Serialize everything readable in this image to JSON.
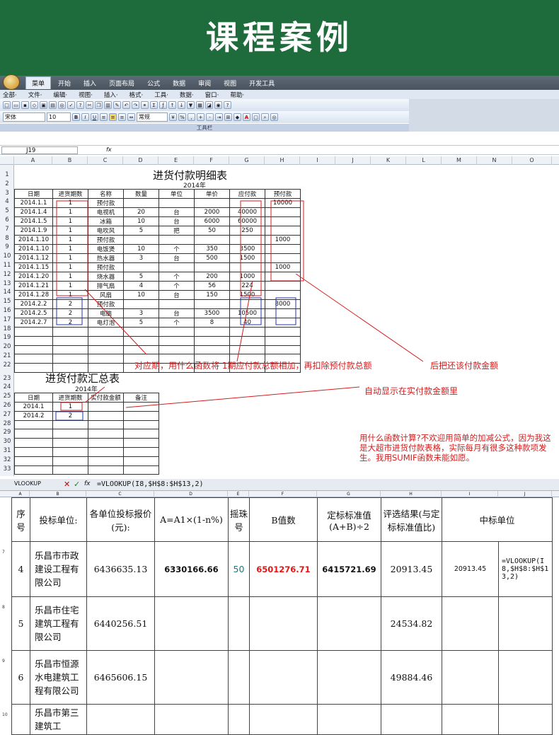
{
  "banner": {
    "title": "课程案例"
  },
  "excel": {
    "ribbon_tabs": [
      "菜单",
      "开始",
      "插入",
      "页面布局",
      "公式",
      "数据",
      "审阅",
      "视图",
      "开发工具"
    ],
    "menu_items": [
      "全部·",
      "文件·",
      "编辑·",
      "视图·",
      "插入·",
      "格式·",
      "工具·",
      "数据·",
      "窗口·",
      "帮助·"
    ],
    "font_name": "宋体",
    "font_size": "10",
    "number_format": "常规",
    "toolbar_label": "工具栏",
    "name_box": "J19",
    "fx_label": "fx",
    "columns": [
      "A",
      "B",
      "C",
      "D",
      "E",
      "F",
      "G",
      "H",
      "I",
      "J",
      "K",
      "L",
      "M",
      "N",
      "O"
    ],
    "rows": [
      "1",
      "2",
      "3",
      "4",
      "5",
      "6",
      "7",
      "8",
      "9",
      "10",
      "11",
      "12",
      "13",
      "14",
      "15",
      "16",
      "17",
      "18",
      "19",
      "20",
      "21",
      "22",
      "23",
      "24",
      "25",
      "26",
      "27",
      "28",
      "29",
      "30",
      "31",
      "32",
      "33"
    ]
  },
  "detail": {
    "title": "进货付款明细表",
    "year": "2014年",
    "headers": [
      "日期",
      "进货期数",
      "名称",
      "数量",
      "单位",
      "单价",
      "应付款",
      "预付款"
    ],
    "rows": [
      [
        "2014.1.1",
        "1",
        "预付款",
        "",
        "",
        "",
        "",
        "10000"
      ],
      [
        "2014.1.4",
        "1",
        "电视机",
        "20",
        "台",
        "2000",
        "40000",
        ""
      ],
      [
        "2014.1.5",
        "1",
        "冰箱",
        "10",
        "台",
        "6000",
        "60000",
        ""
      ],
      [
        "2014.1.9",
        "1",
        "电吹风",
        "5",
        "把",
        "50",
        "250",
        ""
      ],
      [
        "2014.1.10",
        "1",
        "预付款",
        "",
        "",
        "",
        "",
        "1000"
      ],
      [
        "2014.1.10",
        "1",
        "电饭煲",
        "10",
        "个",
        "350",
        "3500",
        ""
      ],
      [
        "2014.1.12",
        "1",
        "热水器",
        "3",
        "台",
        "500",
        "1500",
        ""
      ],
      [
        "2014.1.15",
        "1",
        "预付款",
        "",
        "",
        "",
        "",
        "1000"
      ],
      [
        "2014.1.20",
        "1",
        "烧水器",
        "5",
        "个",
        "200",
        "1000",
        ""
      ],
      [
        "2014.1.21",
        "1",
        "排气扇",
        "4",
        "个",
        "56",
        "224",
        ""
      ],
      [
        "2014.1.28",
        "1",
        "风扇",
        "10",
        "台",
        "150",
        "1500",
        ""
      ],
      [
        "2014.2.2",
        "2",
        "预付款",
        "",
        "",
        "",
        "",
        "8000"
      ],
      [
        "2014.2.5",
        "2",
        "电脑",
        "3",
        "台",
        "3500",
        "10500",
        ""
      ],
      [
        "2014.2.7",
        "2",
        "电灯泡",
        "5",
        "个",
        "8",
        "40",
        ""
      ]
    ]
  },
  "summary": {
    "title": "进货付款汇总表",
    "year": "2014年",
    "headers": [
      "日期",
      "进货期数",
      "实付款金额",
      "备注"
    ],
    "rows": [
      [
        "2014.1",
        "1",
        "",
        ""
      ],
      [
        "2014.2",
        "2",
        "",
        ""
      ]
    ]
  },
  "annotations": {
    "question": "对应期，用什么函数将 1期应付款总额相加，再扣除预付款总额",
    "question_tail": "后把还该付款金额",
    "auto_display": "自动显示在实付款金额里",
    "sumif_note": "用什么函数计算?不欢迎用简单的加减公式，因为我这是大超市进货付款表格，实际每月有很多这种款项发生。我用SUMIF函数未能如愿。"
  },
  "bid": {
    "name_box": "VLOOKUP",
    "formula": "=VLOOKUP(I8,$H$8:$H$13,2)",
    "cols": [
      "A",
      "B",
      "C",
      "D",
      "E",
      "F",
      "G",
      "H",
      "I",
      "J"
    ],
    "headers": {
      "seq": "序号",
      "bidder": "投标单位:",
      "price": "各单位投标报价(元):",
      "a_formula": "A=A1×(1-n%)",
      "ball": "摇珠号",
      "b_value": "B值数",
      "std_value": "定标标准值(A+B)÷2",
      "result": "评选结果(与定标标准值比)",
      "winner": "中标单位"
    },
    "row_numbers": [
      "7",
      "8",
      "9",
      "10"
    ],
    "rows": [
      {
        "seq": "4",
        "bidder": "乐昌市市政建设工程有限公司",
        "price": "6436635.13",
        "a": "6330166.66",
        "ball": "50",
        "b": "6501276.71",
        "std": "6415721.69",
        "result": "20913.45",
        "i": "20913.45",
        "j": "=VLOOKUP(I8,$H$8:$H$13,2)"
      },
      {
        "seq": "5",
        "bidder": "乐昌市住宅建筑工程有限公司",
        "price": "6440256.51",
        "a": "",
        "ball": "",
        "b": "",
        "std": "",
        "result": "24534.82",
        "i": "",
        "j": ""
      },
      {
        "seq": "6",
        "bidder": "乐昌市恒源水电建筑工程有限公司",
        "price": "6465606.15",
        "a": "",
        "ball": "",
        "b": "",
        "std": "",
        "result": "49884.46",
        "i": "",
        "j": ""
      },
      {
        "seq": "",
        "bidder": "乐昌市第三建筑工",
        "price": "",
        "a": "",
        "ball": "",
        "b": "",
        "std": "",
        "result": "",
        "i": "",
        "j": ""
      }
    ]
  },
  "colors": {
    "banner": "#1e6b3c",
    "annotation": "#d31d1d",
    "b_value": "#e11111",
    "ball": "#1a7a7a"
  }
}
